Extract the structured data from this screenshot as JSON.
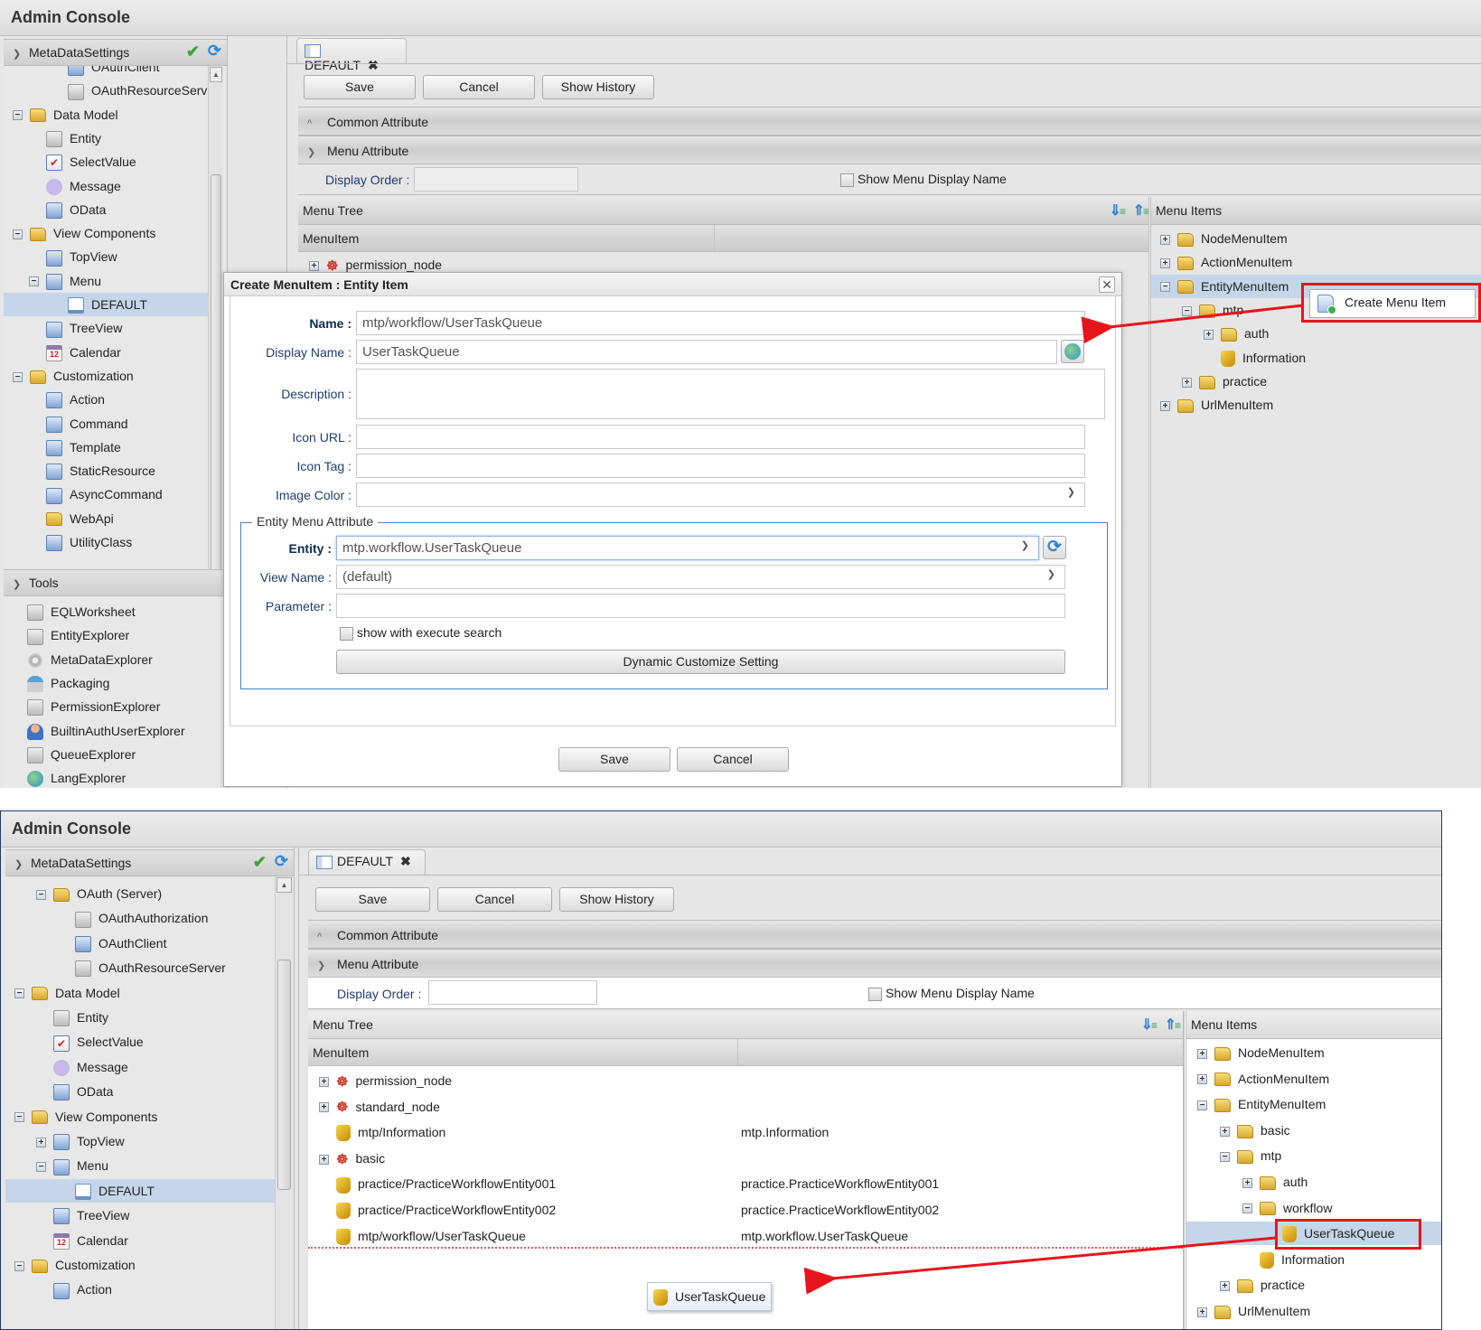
{
  "top": {
    "app_title": "Admin Console",
    "sidebar": {
      "header": "MetaDataSettings",
      "items": [
        {
          "label": "OAuthClient",
          "icon": "oauth-client-icon",
          "level": 2,
          "clipped": true
        },
        {
          "label": "OAuthResourceServer",
          "icon": "oauth-resource-server-icon",
          "level": 2
        },
        {
          "label": "Data Model",
          "icon": "folder-icon",
          "level": 0,
          "toggle": "-"
        },
        {
          "label": "Entity",
          "icon": "entity-icon",
          "level": 1
        },
        {
          "label": "SelectValue",
          "icon": "select-value-icon",
          "level": 1
        },
        {
          "label": "Message",
          "icon": "message-icon",
          "level": 1
        },
        {
          "label": "OData",
          "icon": "odata-icon",
          "level": 1
        },
        {
          "label": "View Components",
          "icon": "folder-icon",
          "level": 0,
          "toggle": "-"
        },
        {
          "label": "TopView",
          "icon": "topview-icon",
          "level": 1
        },
        {
          "label": "Menu",
          "icon": "menu-icon",
          "level": 1,
          "toggle": "-"
        },
        {
          "label": "DEFAULT",
          "icon": "document-icon",
          "level": 2,
          "selected": true
        },
        {
          "label": "TreeView",
          "icon": "treeview-icon",
          "level": 1
        },
        {
          "label": "Calendar",
          "icon": "calendar-icon",
          "level": 1
        },
        {
          "label": "Customization",
          "icon": "folder-icon",
          "level": 0,
          "toggle": "-"
        },
        {
          "label": "Action",
          "icon": "action-icon",
          "level": 1
        },
        {
          "label": "Command",
          "icon": "command-icon",
          "level": 1
        },
        {
          "label": "Template",
          "icon": "template-icon",
          "level": 1
        },
        {
          "label": "StaticResource",
          "icon": "static-resource-icon",
          "level": 1
        },
        {
          "label": "AsyncCommand",
          "icon": "async-command-icon",
          "level": 1
        },
        {
          "label": "WebApi",
          "icon": "webapi-icon",
          "level": 1
        },
        {
          "label": "UtilityClass",
          "icon": "utility-class-icon",
          "level": 1
        }
      ],
      "tools_header": "Tools",
      "tools": [
        {
          "label": "EQLWorksheet",
          "icon": "worksheet-icon"
        },
        {
          "label": "EntityExplorer",
          "icon": "entity-explorer-icon"
        },
        {
          "label": "MetaDataExplorer",
          "icon": "gear-icon"
        },
        {
          "label": "Packaging",
          "icon": "packaging-icon"
        },
        {
          "label": "PermissionExplorer",
          "icon": "permission-explorer-icon"
        },
        {
          "label": "BuiltinAuthUserExplorer",
          "icon": "user-icon"
        },
        {
          "label": "QueueExplorer",
          "icon": "queue-explorer-icon"
        },
        {
          "label": "LangExplorer",
          "icon": "globe-icon",
          "clipped": true
        }
      ]
    },
    "tab": {
      "label": "DEFAULT"
    },
    "toolbar": {
      "save": "Save",
      "cancel": "Cancel",
      "show_history": "Show History"
    },
    "sections": {
      "common": "Common Attribute",
      "menu": "Menu Attribute"
    },
    "display_order_label": "Display Order :",
    "display_order_value": "",
    "show_menu_display_name": "Show Menu Display Name",
    "menu_tree": {
      "title": "Menu Tree",
      "column": "MenuItem",
      "rows": [
        {
          "name": "permission_node",
          "value": ""
        }
      ]
    },
    "menu_items": {
      "title": "Menu Items",
      "items": [
        {
          "label": "NodeMenuItem",
          "level": 0,
          "toggle": "+"
        },
        {
          "label": "ActionMenuItem",
          "level": 0,
          "toggle": "+"
        },
        {
          "label": "EntityMenuItem",
          "level": 0,
          "toggle": "-",
          "selected": true
        },
        {
          "label": "mtp",
          "level": 1,
          "toggle": "-"
        },
        {
          "label": "auth",
          "level": 2,
          "toggle": "+"
        },
        {
          "label": "Information",
          "level": 2,
          "type": "entity"
        },
        {
          "label": "practice",
          "level": 1,
          "toggle": "+"
        },
        {
          "label": "UrlMenuItem",
          "level": 0,
          "toggle": "+"
        }
      ]
    },
    "context_menu": {
      "create_menu_item": "Create Menu Item"
    },
    "dialog": {
      "title": "Create MenuItem : Entity Item",
      "name_label": "Name :",
      "name_value": "mtp/workflow/UserTaskQueue",
      "display_name_label": "Display Name :",
      "display_name_value": "UserTaskQueue",
      "description_label": "Description :",
      "description_value": "",
      "icon_url_label": "Icon URL :",
      "icon_url_value": "",
      "icon_tag_label": "Icon Tag :",
      "icon_tag_value": "",
      "image_color_label": "Image Color :",
      "image_color_value": "",
      "entity_menu_attribute": "Entity Menu Attribute",
      "entity_label": "Entity :",
      "entity_value": "mtp.workflow.UserTaskQueue",
      "view_name_label": "View Name :",
      "view_name_value": "(default)",
      "parameter_label": "Parameter :",
      "parameter_value": "",
      "show_with_execute_search": "show with execute search",
      "show_with_execute_search_checked": false,
      "dynamic_customize_setting": "Dynamic Customize Setting",
      "save": "Save",
      "cancel": "Cancel"
    }
  },
  "bottom": {
    "app_title": "Admin Console",
    "sidebar": {
      "header": "MetaDataSettings",
      "items": [
        {
          "label": "OAuth (Server)",
          "level": 1,
          "toggle": "-",
          "icon": "folder-icon"
        },
        {
          "label": "OAuthAuthorization",
          "level": 2,
          "icon": "oauth-authorization-icon"
        },
        {
          "label": "OAuthClient",
          "level": 2,
          "icon": "oauth-client-icon"
        },
        {
          "label": "OAuthResourceServer",
          "level": 2,
          "icon": "oauth-resource-server-icon"
        },
        {
          "label": "Data Model",
          "level": 0,
          "toggle": "-",
          "icon": "folder-icon"
        },
        {
          "label": "Entity",
          "level": 1,
          "icon": "entity-icon"
        },
        {
          "label": "SelectValue",
          "level": 1,
          "icon": "select-value-icon"
        },
        {
          "label": "Message",
          "level": 1,
          "icon": "message-icon"
        },
        {
          "label": "OData",
          "level": 1,
          "icon": "odata-icon"
        },
        {
          "label": "View Components",
          "level": 0,
          "toggle": "-",
          "icon": "folder-icon"
        },
        {
          "label": "TopView",
          "level": 1,
          "toggle": "+",
          "icon": "topview-icon"
        },
        {
          "label": "Menu",
          "level": 1,
          "toggle": "-",
          "icon": "menu-icon"
        },
        {
          "label": "DEFAULT",
          "level": 2,
          "icon": "document-icon",
          "selected": true
        },
        {
          "label": "TreeView",
          "level": 1,
          "icon": "treeview-icon"
        },
        {
          "label": "Calendar",
          "level": 1,
          "icon": "calendar-icon"
        },
        {
          "label": "Customization",
          "level": 0,
          "toggle": "-",
          "icon": "folder-icon"
        },
        {
          "label": "Action",
          "level": 1,
          "icon": "action-icon"
        }
      ]
    },
    "tab": {
      "label": "DEFAULT"
    },
    "toolbar": {
      "save": "Save",
      "cancel": "Cancel",
      "show_history": "Show History"
    },
    "sections": {
      "common": "Common Attribute",
      "menu": "Menu Attribute"
    },
    "display_order_label": "Display Order :",
    "display_order_value": "",
    "show_menu_display_name": "Show Menu Display Name",
    "menu_tree": {
      "title": "Menu Tree",
      "column": "MenuItem",
      "rows": [
        {
          "name": "permission_node",
          "value": "",
          "type": "node",
          "toggle": "+"
        },
        {
          "name": "standard_node",
          "value": "",
          "type": "node",
          "toggle": "+"
        },
        {
          "name": "mtp/Information",
          "value": "mtp.Information",
          "type": "entity"
        },
        {
          "name": "basic",
          "value": "",
          "type": "node",
          "toggle": "+"
        },
        {
          "name": "practice/PracticeWorkflowEntity001",
          "value": "practice.PracticeWorkflowEntity001",
          "type": "entity"
        },
        {
          "name": "practice/PracticeWorkflowEntity002",
          "value": "practice.PracticeWorkflowEntity002",
          "type": "entity"
        },
        {
          "name": "mtp/workflow/UserTaskQueue",
          "value": "mtp.workflow.UserTaskQueue",
          "type": "entity"
        }
      ],
      "drag_ghost": "UserTaskQueue"
    },
    "menu_items": {
      "title": "Menu Items",
      "items": [
        {
          "label": "NodeMenuItem",
          "level": 0,
          "toggle": "+"
        },
        {
          "label": "ActionMenuItem",
          "level": 0,
          "toggle": "+"
        },
        {
          "label": "EntityMenuItem",
          "level": 0,
          "toggle": "-"
        },
        {
          "label": "basic",
          "level": 1,
          "toggle": "+"
        },
        {
          "label": "mtp",
          "level": 1,
          "toggle": "-"
        },
        {
          "label": "auth",
          "level": 2,
          "toggle": "+"
        },
        {
          "label": "workflow",
          "level": 2,
          "toggle": "-"
        },
        {
          "label": "UserTaskQueue",
          "level": 3,
          "type": "entity",
          "selected": true
        },
        {
          "label": "Information",
          "level": 2,
          "type": "entity"
        },
        {
          "label": "practice",
          "level": 1,
          "toggle": "+"
        },
        {
          "label": "UrlMenuItem",
          "level": 0,
          "toggle": "+"
        }
      ]
    }
  },
  "colors": {
    "annotation_red": "#e8141b",
    "selection_blue": "#c6d6ea",
    "fieldset_border": "#4a7fc0"
  }
}
